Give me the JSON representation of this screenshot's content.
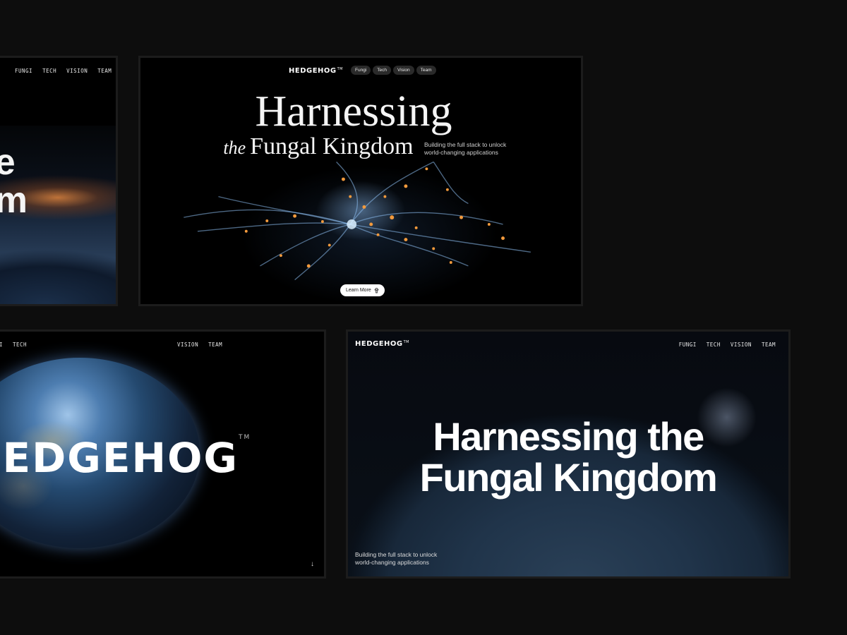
{
  "frame1": {
    "nav": [
      "FUNGI",
      "TECH",
      "VISION",
      "TEAM"
    ],
    "headline_line1": "he",
    "headline_line2": "om"
  },
  "frame2": {
    "logo": "HEDGEHOG",
    "logo_mark": "TM",
    "nav": [
      "Fungi",
      "Tech",
      "Vision",
      "Team"
    ],
    "title_line1": "Harnessing",
    "title_line2_italic": "the",
    "title_line2": "Fungal Kingdom",
    "subtitle_line1": "Building the full stack to unlock",
    "subtitle_line2": "world-changing applications",
    "cta_label": "Learn More"
  },
  "frame3": {
    "nav_left": [
      "I",
      "TECH"
    ],
    "nav_right": [
      "VISION",
      "TEAM"
    ],
    "big_logo": "HEDGEHOG",
    "big_logo_mark": "TM",
    "side_text": "ck",
    "arrow": "↓"
  },
  "frame4": {
    "logo": "HEDGEHOG",
    "logo_mark": "TM",
    "nav": [
      "FUNGI",
      "TECH",
      "VISION",
      "TEAM"
    ],
    "headline_line1": "Harnessing the",
    "headline_line2": "Fungal Kingdom",
    "subtitle_line1": "Building the full stack to unlock",
    "subtitle_line2": "world-changing applications"
  }
}
